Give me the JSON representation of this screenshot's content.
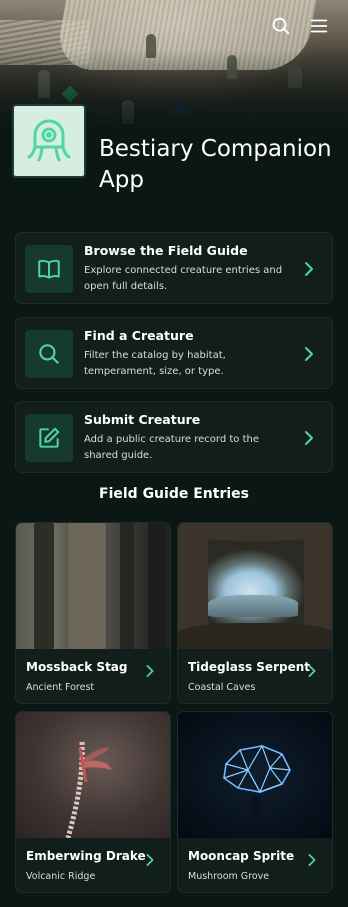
{
  "header": {
    "search_icon": "search-icon",
    "menu_icon": "hamburger-menu-icon"
  },
  "app": {
    "title": "Bestiary Companion App",
    "logo_icon": "cyclops-creature-icon"
  },
  "actions": [
    {
      "title": "Browse the Field Guide",
      "description": "Explore connected creature entries and open full details.",
      "icon": "book-open-icon"
    },
    {
      "title": "Find a Creature",
      "description": "Filter the catalog by habitat, temperament, size, or type.",
      "icon": "search-icon"
    },
    {
      "title": "Submit Creature",
      "description": "Add a public creature record to the shared guide.",
      "icon": "edit-icon"
    }
  ],
  "entries_section": {
    "title": "Field Guide Entries"
  },
  "entries": [
    {
      "name": "Mossback Stag",
      "location": "Ancient Forest"
    },
    {
      "name": "Tideglass Serpent",
      "location": "Coastal Caves"
    },
    {
      "name": "Emberwing Drake",
      "location": "Volcanic Ridge"
    },
    {
      "name": "Mooncap Sprite",
      "location": "Mushroom Grove"
    }
  ],
  "colors": {
    "background": "#0b1714",
    "card": "#121e1b",
    "accent": "#4fd6a4",
    "icon_box": "#163a2f"
  }
}
